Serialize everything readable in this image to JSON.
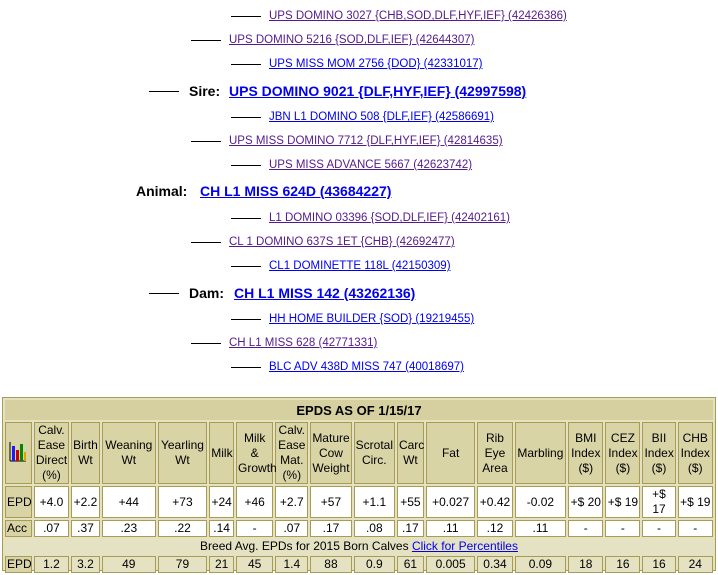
{
  "pedigree": {
    "sire_sire_sire": "UPS DOMINO 3027 {CHB,SOD,DLF,HYF,IEF} (42426386)",
    "sire_sire": "UPS DOMINO 5216 {SOD,DLF,IEF} (42644307)",
    "sire_sire_dam": "UPS MISS MOM 2756 {DOD} (42331017)",
    "sire_label": "Sire:",
    "sire": "UPS DOMINO 9021 {DLF,HYF,IEF} (42997598)",
    "sire_dam_sire": "JBN L1 DOMINO 508 {DLF,IEF} (42586691)",
    "sire_dam": "UPS MISS DOMINO 7712 {DLF,HYF,IEF} (42814635)",
    "sire_dam_dam": "UPS MISS ADVANCE 5667 (42623742)",
    "animal_label": "Animal:",
    "animal": "CH L1 MISS 624D (43684227)",
    "dam_sire_sire": "L1 DOMINO 03396 {SOD,DLF,IEF} (42402161)",
    "dam_sire": "CL 1 DOMINO 637S 1ET {CHB} (42692477)",
    "dam_sire_dam": "CL1 DOMINETTE 118L (42150309)",
    "dam_label": "Dam:",
    "dam": "CH L1 MISS 142 (43262136)",
    "dam_dam_sire": "HH HOME BUILDER {SOD} (19219455)",
    "dam_dam": "CH L1 MISS 628 (42771331)",
    "dam_dam_dam": "BLC ADV 438D MISS 747 (40018697)"
  },
  "epd_table": {
    "title": "EPDS AS OF 1/15/17",
    "headers": [
      [
        "Calv.",
        "Ease",
        "Direct",
        "(%)"
      ],
      [
        "Birth",
        "Wt"
      ],
      [
        "Weaning",
        "Wt"
      ],
      [
        "Yearling",
        "Wt"
      ],
      [
        "Milk"
      ],
      [
        "Milk",
        "&",
        "Growth"
      ],
      [
        "Calv.",
        "Ease",
        "Mat.",
        "(%)"
      ],
      [
        "Mature",
        "Cow",
        "Weight"
      ],
      [
        "Scrotal",
        "Circ."
      ],
      [
        "Carc",
        "Wt"
      ],
      [
        "Fat"
      ],
      [
        "Rib",
        "Eye",
        "Area"
      ],
      [
        "Marbling"
      ],
      [
        "BMI",
        "Index",
        "($)"
      ],
      [
        "CEZ",
        "Index",
        "($)"
      ],
      [
        "BII",
        "Index",
        "($)"
      ],
      [
        "CHB",
        "Index",
        "($)"
      ]
    ],
    "epd_label": "EPD",
    "epd": [
      "+4.0",
      "+2.2",
      "+44",
      "+73",
      "+24",
      "+46",
      "+2.7",
      "+57",
      "+1.1",
      "+55",
      "+0.027",
      "+0.42",
      "-0.02",
      "+$ 20",
      "+$ 19",
      "+$ 17",
      "+$ 19"
    ],
    "acc_label": "Acc",
    "acc": [
      ".07",
      ".37",
      ".23",
      ".22",
      ".14",
      "-",
      ".07",
      ".17",
      ".08",
      ".17",
      ".11",
      ".12",
      ".11",
      "-",
      "-",
      "-",
      "-"
    ],
    "breed_avg_text": "Breed Avg. EPDs for 2015 Born Calves ",
    "percentiles_link": "Click for Percentiles",
    "avg_label": "EPD",
    "avg": [
      "1.2",
      "3.2",
      "49",
      "79",
      "21",
      "45",
      "1.4",
      "88",
      "0.9",
      "61",
      "0.005",
      "0.34",
      "0.09",
      "18",
      "16",
      "16",
      "24"
    ]
  },
  "colors": {
    "panel": "#e5e2c4",
    "header": "#d9d4a6",
    "border": "#a89c52",
    "link": "#0000ee",
    "visited": "#551a8b"
  },
  "icons": [
    "bar-chart-icon"
  ]
}
